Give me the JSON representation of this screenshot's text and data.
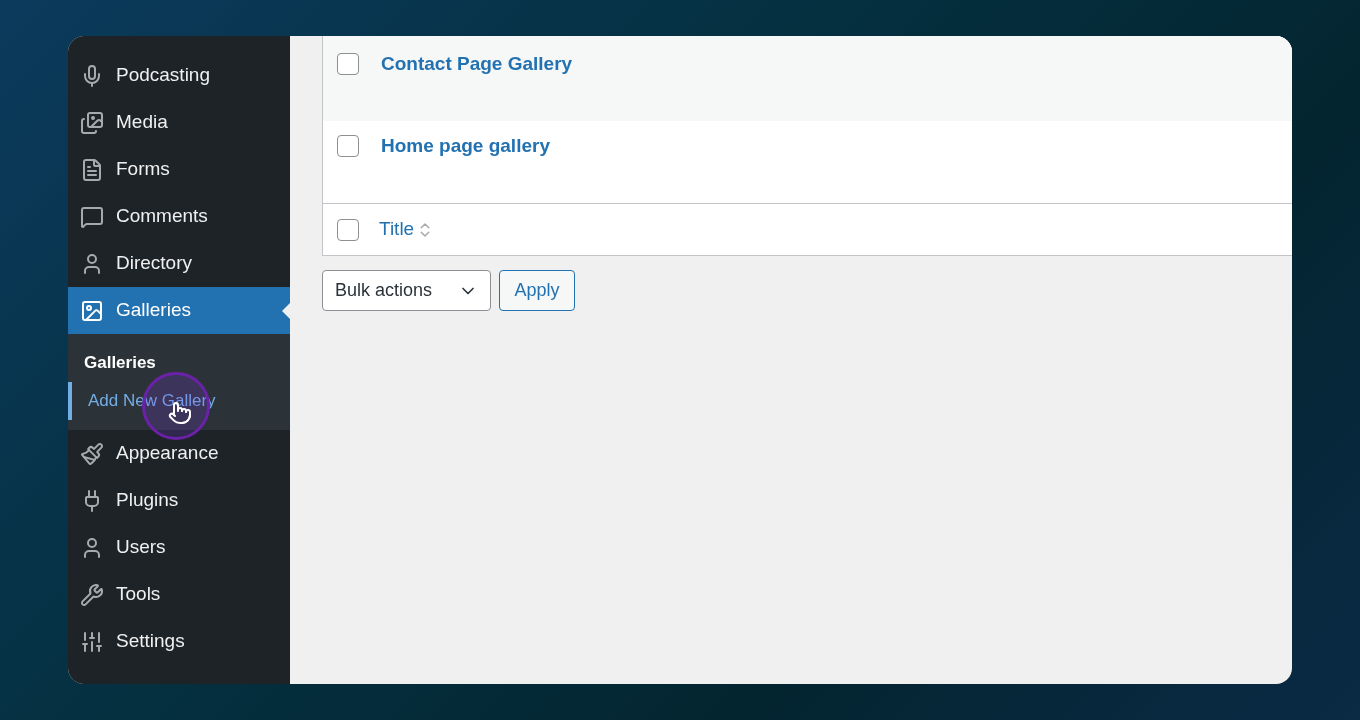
{
  "sidebar": {
    "items": [
      {
        "label": "Podcasting",
        "selected": false
      },
      {
        "label": "Media",
        "selected": false
      },
      {
        "label": "Forms",
        "selected": false
      },
      {
        "label": "Comments",
        "selected": false
      },
      {
        "label": "Directory",
        "selected": false
      },
      {
        "label": "Galleries",
        "selected": true,
        "submenu": [
          {
            "label": "Galleries",
            "selected": true,
            "hovered": false
          },
          {
            "label": "Add New Gallery",
            "selected": false,
            "hovered": true
          }
        ]
      },
      {
        "label": "Appearance",
        "selected": false
      },
      {
        "label": "Plugins",
        "selected": false
      },
      {
        "label": "Users",
        "selected": false
      },
      {
        "label": "Tools",
        "selected": false
      },
      {
        "label": "Settings",
        "selected": false
      }
    ]
  },
  "table": {
    "rows": [
      {
        "title": "Contact Page Gallery",
        "checked": false
      },
      {
        "title": "Home page gallery",
        "checked": false
      }
    ],
    "footer": {
      "column": "Title",
      "checked": false
    }
  },
  "bulk_actions": {
    "value": "Bulk actions",
    "button": "Apply"
  }
}
